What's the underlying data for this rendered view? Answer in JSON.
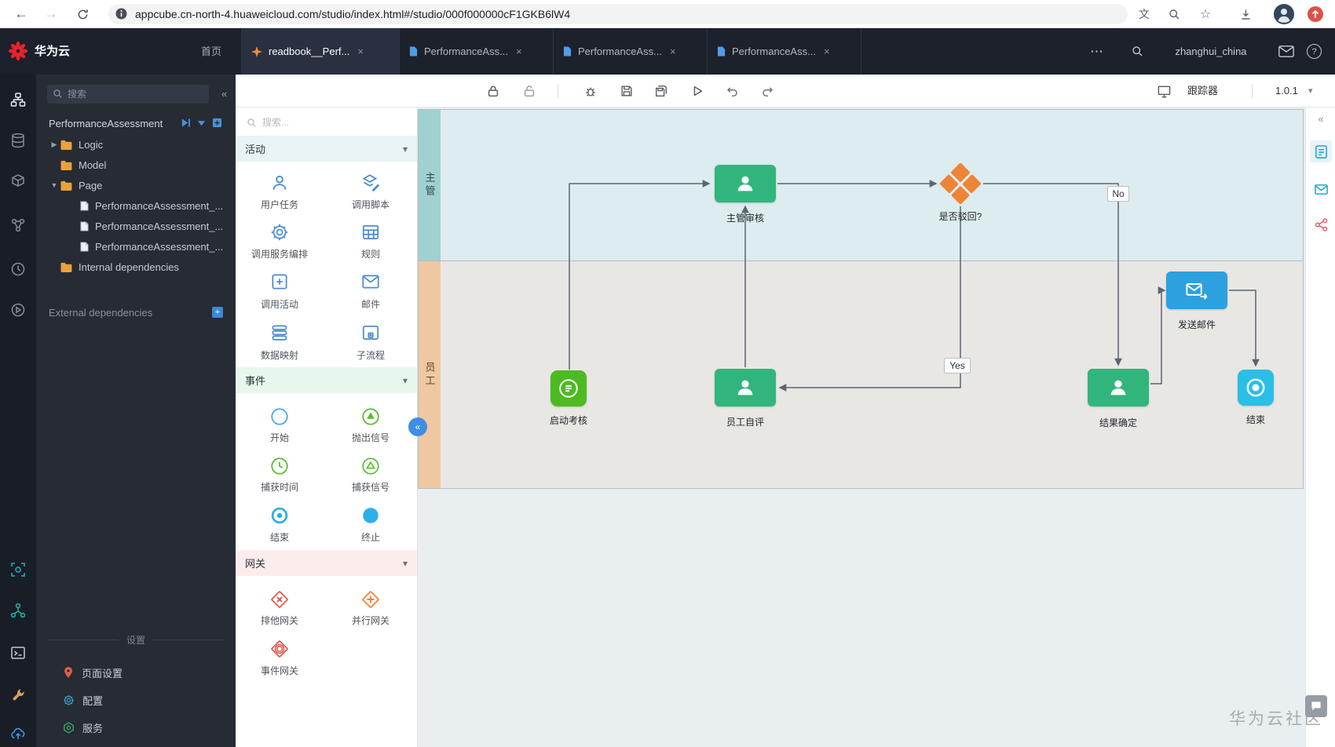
{
  "browser": {
    "url": "appcube.cn-north-4.huaweicloud.com/studio/index.html#/studio/000f000000cF1GKB6lW4"
  },
  "header": {
    "brand": "华为云",
    "home": "首页",
    "user": "zhanghui_china",
    "tabs": [
      {
        "label": "readbook__Perf..."
      },
      {
        "label": "PerformanceAss..."
      },
      {
        "label": "PerformanceAss..."
      },
      {
        "label": "PerformanceAss..."
      }
    ]
  },
  "explorer": {
    "search_placeholder": "搜索",
    "project_name": "PerformanceAssessment",
    "nodes": {
      "logic": "Logic",
      "model": "Model",
      "page": "Page",
      "internal": "Internal dependencies",
      "external": "External dependencies"
    },
    "page_children": [
      "PerformanceAssessment_...",
      "PerformanceAssessment_...",
      "PerformanceAssessment_..."
    ],
    "settings": {
      "label": "设置",
      "items": [
        "页面设置",
        "配置",
        "服务"
      ]
    }
  },
  "toolbar": {
    "tracker": "跟踪器",
    "version": "1.0.1"
  },
  "palette": {
    "search_placeholder": "搜索...",
    "sections": [
      {
        "title": "活动",
        "items": [
          {
            "label": "用户任务"
          },
          {
            "label": "调用脚本"
          },
          {
            "label": "调用服务编排"
          },
          {
            "label": "规则"
          },
          {
            "label": "调用活动"
          },
          {
            "label": "邮件"
          },
          {
            "label": "数据映射"
          },
          {
            "label": "子流程"
          }
        ]
      },
      {
        "title": "事件",
        "items": [
          {
            "label": "开始"
          },
          {
            "label": "抛出信号"
          },
          {
            "label": "捕获时间"
          },
          {
            "label": "捕获信号"
          },
          {
            "label": "结束"
          },
          {
            "label": "终止"
          }
        ]
      },
      {
        "title": "网关",
        "items": [
          {
            "label": "排他网关"
          },
          {
            "label": "并行网关"
          },
          {
            "label": "事件网关"
          }
        ]
      }
    ]
  },
  "canvas": {
    "lanes": [
      {
        "label": "主管"
      },
      {
        "label": "员工"
      }
    ],
    "nodes": {
      "start": "启动考核",
      "self_review": "员工自评",
      "manager_review": "主管审核",
      "gateway": "是否驳回?",
      "result": "结果确定",
      "send_mail": "发送邮件",
      "end": "结束"
    },
    "edge_labels": {
      "no": "No",
      "yes": "Yes"
    }
  },
  "watermark": "华为云社区",
  "icons": {
    "back": "←",
    "forward": "→",
    "more": "⋯",
    "help": "?",
    "close": "×",
    "star": "☆",
    "translate": "文",
    "collapse": "«",
    "chevron_down": "▾",
    "tree_collapsed": "▶",
    "tree_expanded": "▼",
    "plus": "+"
  },
  "colors": {
    "task_green": "#31b57d",
    "gateway_orange": "#ee8435",
    "mail_blue": "#2ba2df",
    "start_green": "#4eba21",
    "end_cyan": "#29bfe6",
    "lane_supervisor_strip": "#9ed1cf",
    "lane_employee_strip": "#f0c7a0",
    "header_bg": "#1c212b",
    "accent_blue": "#3d8fe6"
  }
}
